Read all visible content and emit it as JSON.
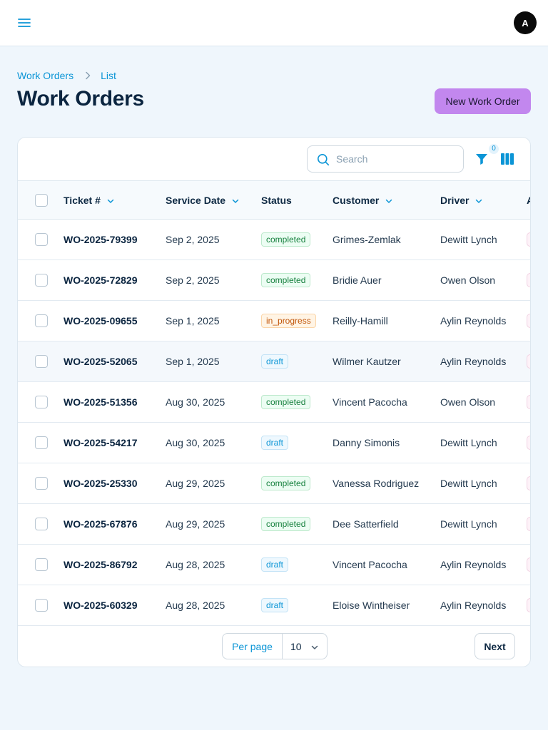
{
  "topbar": {
    "avatar_initial": "A"
  },
  "breadcrumb": {
    "items": [
      "Work Orders",
      "List"
    ]
  },
  "page": {
    "title": "Work Orders",
    "new_button": "New Work Order"
  },
  "toolbar": {
    "search_placeholder": "Search",
    "filter_count": "0"
  },
  "table": {
    "columns": [
      "Ticket #",
      "Service Date",
      "Status",
      "Customer",
      "Driver",
      "A"
    ],
    "rows": [
      {
        "ticket": "WO-2025-79399",
        "date": "Sep 2, 2025",
        "status": "completed",
        "customer": "Grimes-Zemlak",
        "driver": "Dewitt Lynch"
      },
      {
        "ticket": "WO-2025-72829",
        "date": "Sep 2, 2025",
        "status": "completed",
        "customer": "Bridie Auer",
        "driver": "Owen Olson"
      },
      {
        "ticket": "WO-2025-09655",
        "date": "Sep 1, 2025",
        "status": "in_progress",
        "customer": "Reilly-Hamill",
        "driver": "Aylin Reynolds"
      },
      {
        "ticket": "WO-2025-52065",
        "date": "Sep 1, 2025",
        "status": "draft",
        "customer": "Wilmer Kautzer",
        "driver": "Aylin Reynolds"
      },
      {
        "ticket": "WO-2025-51356",
        "date": "Aug 30, 2025",
        "status": "completed",
        "customer": "Vincent Pacocha",
        "driver": "Owen Olson"
      },
      {
        "ticket": "WO-2025-54217",
        "date": "Aug 30, 2025",
        "status": "draft",
        "customer": "Danny Simonis",
        "driver": "Dewitt Lynch"
      },
      {
        "ticket": "WO-2025-25330",
        "date": "Aug 29, 2025",
        "status": "completed",
        "customer": "Vanessa Rodriguez",
        "driver": "Dewitt Lynch"
      },
      {
        "ticket": "WO-2025-67876",
        "date": "Aug 29, 2025",
        "status": "completed",
        "customer": "Dee Satterfield",
        "driver": "Dewitt Lynch"
      },
      {
        "ticket": "WO-2025-86792",
        "date": "Aug 28, 2025",
        "status": "draft",
        "customer": "Vincent Pacocha",
        "driver": "Aylin Reynolds"
      },
      {
        "ticket": "WO-2025-60329",
        "date": "Aug 28, 2025",
        "status": "draft",
        "customer": "Eloise Wintheiser",
        "driver": "Aylin Reynolds"
      }
    ]
  },
  "pagination": {
    "per_page_label": "Per page",
    "per_page_value": "10",
    "next_label": "Next"
  },
  "colors": {
    "accent": "#0b95d6",
    "primary_button": "#c287ee",
    "page_bg": "#eff6fc"
  }
}
